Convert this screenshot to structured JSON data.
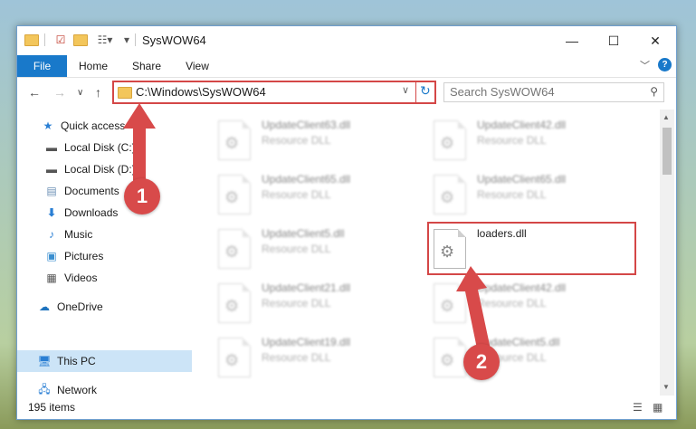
{
  "window": {
    "title": "SysWOW64",
    "minimize": "—",
    "maximize": "☐",
    "close": "✕"
  },
  "ribbon": {
    "tabs": [
      "File",
      "Home",
      "Share",
      "View"
    ],
    "expand": "﹀",
    "help": "?"
  },
  "nav": {
    "back": "←",
    "forward": "→",
    "recent": "∨",
    "up": "↑",
    "address": "C:\\Windows\\SysWOW64",
    "address_dropdown": "∨",
    "refresh": "↻",
    "search_placeholder": "Search SysWOW64",
    "search_icon": "⚲"
  },
  "sidebar": {
    "items": [
      {
        "label": "Quick access",
        "icon": "star-icon"
      },
      {
        "label": "Local Disk (C:)",
        "icon": "disk-icon",
        "pinned": true
      },
      {
        "label": "Local Disk (D:)",
        "icon": "disk-icon",
        "pinned": true
      },
      {
        "label": "Documents",
        "icon": "document-icon",
        "pinned": true
      },
      {
        "label": "Downloads",
        "icon": "download-icon",
        "pinned": true
      },
      {
        "label": "Music",
        "icon": "music-icon",
        "pinned": true
      },
      {
        "label": "Pictures",
        "icon": "pictures-icon",
        "pinned": true
      },
      {
        "label": "Videos",
        "icon": "videos-icon",
        "pinned": true
      },
      {
        "label": "OneDrive",
        "icon": "cloud-icon"
      },
      {
        "label": "This PC",
        "icon": "computer-icon",
        "selected": true
      },
      {
        "label": "Network",
        "icon": "network-icon"
      }
    ],
    "pin_glyph": "📌"
  },
  "files": [
    {
      "name": "UpdateClient63.dll",
      "type": "Resource DLL",
      "blurred": true
    },
    {
      "name": "UpdateClient42.dll",
      "type": "Resource DLL",
      "blurred": true
    },
    {
      "name": "UpdateClient65.dll",
      "type": "Resource DLL",
      "blurred": true
    },
    {
      "name": "UpdateClient65.dll",
      "type": "Resource DLL",
      "blurred": true
    },
    {
      "name": "UpdateClient5.dll",
      "type": "Resource DLL",
      "blurred": true
    },
    {
      "name": "loaders.dll",
      "type": "",
      "blurred": false
    },
    {
      "name": "UpdateClient21.dll",
      "type": "Resource DLL",
      "blurred": true
    },
    {
      "name": "UpdateClient42.dll",
      "type": "Resource DLL",
      "blurred": true
    },
    {
      "name": "UpdateClient19.dll",
      "type": "Resource DLL",
      "blurred": true
    },
    {
      "name": "UpdateClient5.dll",
      "type": "Resource DLL",
      "blurred": true
    }
  ],
  "status": {
    "item_count": "195 items"
  },
  "annotations": {
    "step1": "1",
    "step2": "2",
    "color": "#d44747"
  }
}
